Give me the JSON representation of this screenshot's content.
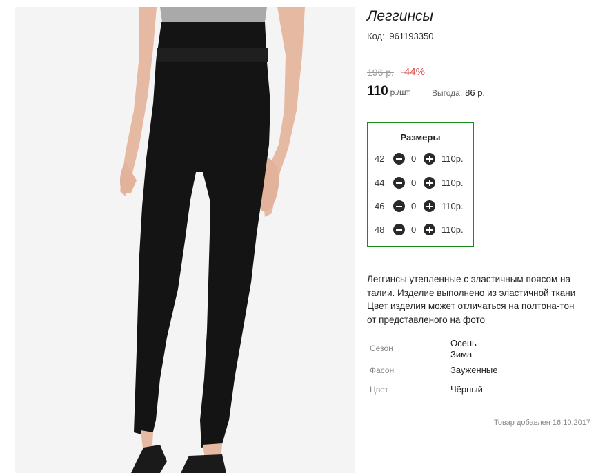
{
  "product": {
    "title": "Леггинсы",
    "code_label": "Код:",
    "code": "961193350",
    "image_alt": "leggings-product-photo"
  },
  "price": {
    "old": "196 р.",
    "discount": "-44%",
    "current": "110",
    "unit": "р./шт.",
    "saving_label": "Выгода:",
    "saving_value": "86 р.",
    "discount_color": "#d9534f"
  },
  "sizes": {
    "title": "Размеры",
    "border_color": "#1d8a1d",
    "rows": [
      {
        "size": "42",
        "qty": "0",
        "price": "110р."
      },
      {
        "size": "44",
        "qty": "0",
        "price": "110р."
      },
      {
        "size": "46",
        "qty": "0",
        "price": "110р."
      },
      {
        "size": "48",
        "qty": "0",
        "price": "110р."
      }
    ]
  },
  "description": {
    "lines": [
      "Леггинсы утепленные с эластичным поясом на",
      "талии. Изделие выполнено из эластичной ткани",
      "Цвет изделия может отличаться на полтона-тон",
      "от представленого на фото"
    ]
  },
  "specs": [
    {
      "label": "Сезон",
      "value_line1": "Осень-",
      "value_line2": "Зима"
    },
    {
      "label": "Фасон",
      "value_line1": "Зауженные"
    },
    {
      "label": "Цвет",
      "value_line1": "Чёрный"
    }
  ],
  "footer": {
    "added": "Товар добавлен 16.10.2017"
  }
}
